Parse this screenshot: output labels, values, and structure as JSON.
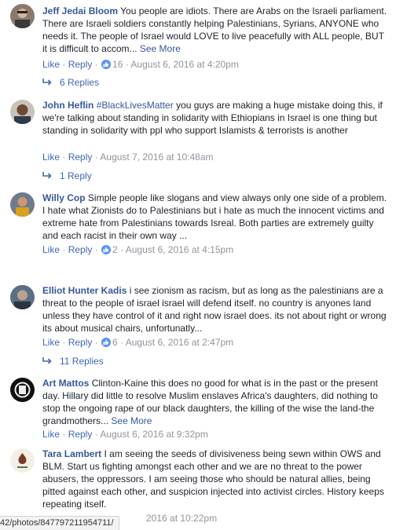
{
  "comments": [
    {
      "author": "Jeff Jedai Bloom",
      "text": "You people are idiots. There are Arabs on the Israeli parliament. There are Israeli soldiers constantly helping Palestinians, Syrians, ANYONE who needs it. The people of Israel would LOVE to live peacefully with ALL people, BUT it is difficult to accom...",
      "see_more": "See More",
      "like_label": "Like",
      "reply_label": "Reply",
      "reaction_count": "16",
      "timestamp": "August 6, 2016 at 4:20pm",
      "replies_label": "6 Replies"
    },
    {
      "author": "John Heflin",
      "hashtag": "#BlackLivesMatter",
      "text": "you guys are making a huge mistake doing this, if we're talking about standing in solidarity with Ethiopians in Israel is one thing but standing in solidarity with ppl who support Islamists & terrorists is another",
      "like_label": "Like",
      "reply_label": "Reply",
      "timestamp": "August 7, 2016 at 10:48am",
      "replies_label": "1 Reply"
    },
    {
      "author": "Willy Cop",
      "text": "Simple people like slogans and view always only one side of a problem. I hate what Zionists do to Palestinians but i hate as much the innocent victims and extreme hate from Palestinians towards Isreal. Both parties are extremely guilty and each racist in their own way ...",
      "like_label": "Like",
      "reply_label": "Reply",
      "reaction_count": "2",
      "timestamp": "August 6, 2016 at 4:15pm"
    },
    {
      "author": "Elliot Hunter Kadis",
      "text": "i see zionism as racism, but as long as the palestinians are a threat to the people of israel israel will defend itself. no country is anyones land unless they have control of it and right now israel does. its not about right or wrong its about musical chairs, unfortunatly...",
      "like_label": "Like",
      "reply_label": "Reply",
      "reaction_count": "6",
      "timestamp": "August 6, 2016 at 2:47pm",
      "replies_label": "11 Replies"
    },
    {
      "author": "Art Mattos",
      "text": "Clinton-Kaine this does no good for what is in the past or the present day. Hillary did little to resolve Muslim enslaves Africa's daughters, did nothing to stop the ongoing rape of our black daughters, the killing of the wise the land-the grandmothers...",
      "see_more": "See More",
      "like_label": "Like",
      "reply_label": "Reply",
      "timestamp": "August 6, 2016 at 9:32pm"
    },
    {
      "author": "Tara Lambert",
      "text": "I am seeing the seeds of divisiveness being sewn within OWS and BLM. Start us fighting amongst each other and we are no threat to the power abusers, the oppressors. I am seeing those who should be natural allies, being pitted against each other, and suspicion injected into activist circles. History keeps repeating itself.",
      "timestamp": "2016 at 10:22pm"
    }
  ],
  "status_bar": {
    "url": "42/photos/847797211954711/"
  },
  "colors": {
    "link": "#365899",
    "action": "#4267b2",
    "meta": "#90949c",
    "like_badge": "#5890ff"
  }
}
